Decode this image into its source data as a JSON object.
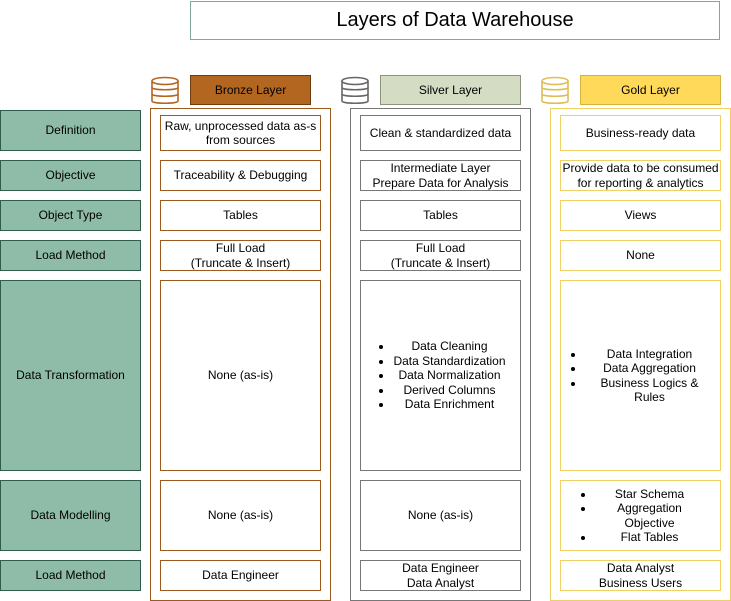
{
  "title": "Layers of Data Warehouse",
  "layers": {
    "bronze": {
      "label": "Bronze Layer",
      "header_bg": "#b2661f",
      "accent": "#c17a2f"
    },
    "silver": {
      "label": "Silver Layer",
      "header_bg": "#d4dcc3",
      "accent": "#808080"
    },
    "gold": {
      "label": "Gold Layer",
      "header_bg": "#ffd95a",
      "accent": "#e6c560"
    }
  },
  "rows": {
    "definition": {
      "label": "Definition",
      "bronze": [
        "Raw, unprocessed data as-s",
        "from sources"
      ],
      "silver": [
        "Clean & standardized data"
      ],
      "gold": [
        "Business-ready data"
      ]
    },
    "objective": {
      "label": "Objective",
      "bronze": [
        "Traceability & Debugging"
      ],
      "silver": [
        "Intermediate Layer",
        "Prepare Data for Analysis"
      ],
      "gold": [
        "Provide data to be consumed",
        "for reporting & analytics"
      ]
    },
    "object_type": {
      "label": "Object Type",
      "bronze": [
        "Tables"
      ],
      "silver": [
        "Tables"
      ],
      "gold": [
        "Views"
      ]
    },
    "load_method": {
      "label": "Load Method",
      "bronze": [
        "Full Load",
        "(Truncate & Insert)"
      ],
      "silver": [
        "Full Load",
        "(Truncate & Insert)"
      ],
      "gold": [
        "None"
      ]
    },
    "data_transformation": {
      "label": "Data Transformation",
      "bronze": [
        "None (as-is)"
      ],
      "silver": [
        "Data Cleaning",
        "Data Standardization",
        "Data Normalization",
        "Derived Columns",
        "Data Enrichment"
      ],
      "gold": [
        "Data Integration",
        "Data Aggregation",
        "Business Logics & Rules"
      ]
    },
    "data_modelling": {
      "label": "Data Modelling",
      "bronze": [
        "None (as-is)"
      ],
      "silver": [
        "None (as-is)"
      ],
      "gold": [
        "Star Schema",
        "Aggregation Objective",
        "Flat Tables"
      ]
    },
    "target_audience": {
      "label": "Load Method",
      "bronze": [
        "Data Engineer"
      ],
      "silver": [
        "Data Engineer",
        "Data Analyst"
      ],
      "gold": [
        "Data Analyst",
        "Business Users"
      ]
    }
  }
}
